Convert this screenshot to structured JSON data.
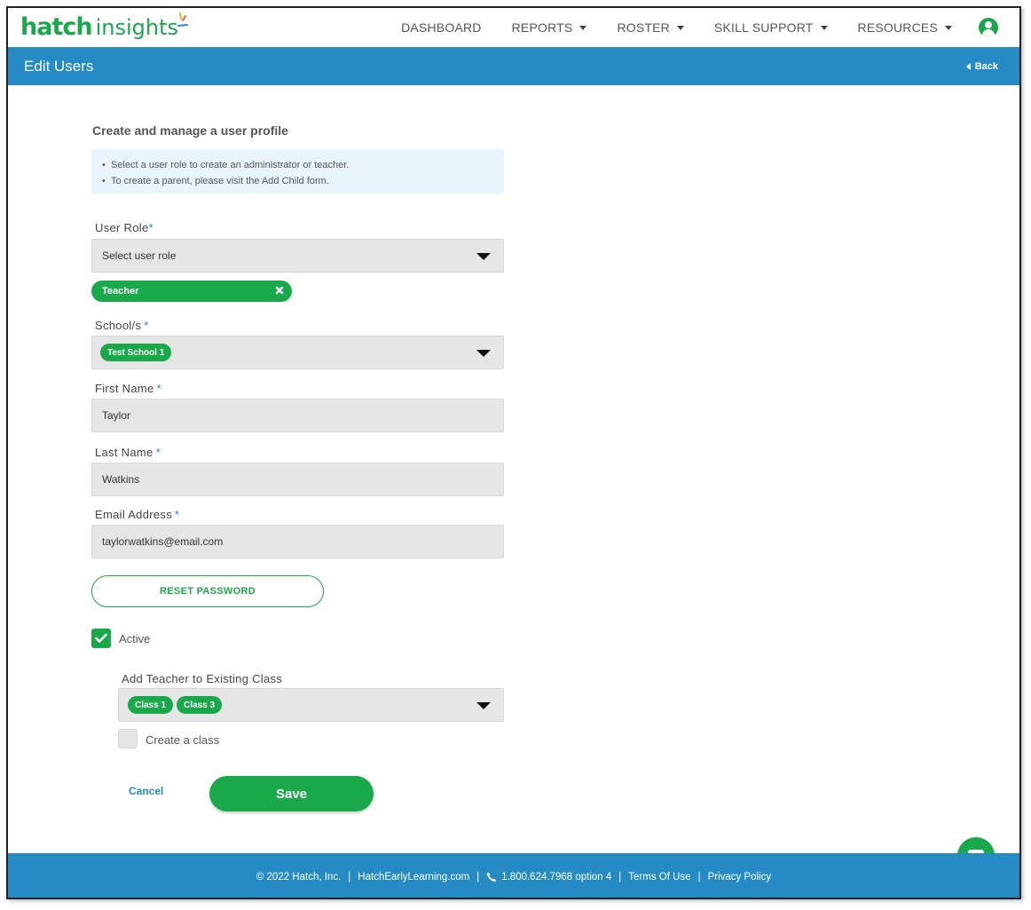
{
  "brand": {
    "logo_bold": "hatch",
    "logo_light": "insights",
    "accent_green": "#1aa94a",
    "accent_blue": "#268bc4"
  },
  "nav": {
    "items": [
      {
        "label": "DASHBOARD",
        "dropdown": false
      },
      {
        "label": "REPORTS",
        "dropdown": true
      },
      {
        "label": "ROSTER",
        "dropdown": true
      },
      {
        "label": "SKILL SUPPORT",
        "dropdown": true
      },
      {
        "label": "RESOURCES",
        "dropdown": true
      }
    ],
    "account_icon": "user-circle-icon"
  },
  "page": {
    "title": "Edit Users",
    "back_label": "Back"
  },
  "form": {
    "heading": "Create and manage a user profile",
    "info": [
      "Select a user role to create an administrator or teacher.",
      "To create a parent, please visit the Add Child form."
    ],
    "user_role": {
      "label": "User Role",
      "placeholder": "Select user role",
      "selected_chip": "Teacher"
    },
    "schools": {
      "label": "School/s",
      "selected": [
        "Test School 1"
      ]
    },
    "first_name": {
      "label": "First Name",
      "value": "Taylor"
    },
    "last_name": {
      "label": "Last Name",
      "value": "Watkins"
    },
    "email": {
      "label": "Email Address",
      "value": "taylorwatkins@email.com"
    },
    "reset_password_label": "RESET PASSWORD",
    "active": {
      "label": "Active",
      "checked": true
    },
    "existing_class": {
      "label": "Add Teacher to Existing Class",
      "selected": [
        "Class 1",
        "Class 3"
      ]
    },
    "create_class": {
      "label": "Create a class",
      "checked": false
    },
    "cancel_label": "Cancel",
    "save_label": "Save"
  },
  "footer": {
    "copyright": "© 2022 Hatch, Inc.",
    "site": "HatchEarlyLearning.com",
    "phone": "1.800.624.7968 option 4",
    "terms": "Terms Of Use",
    "privacy": "Privacy Policy"
  }
}
